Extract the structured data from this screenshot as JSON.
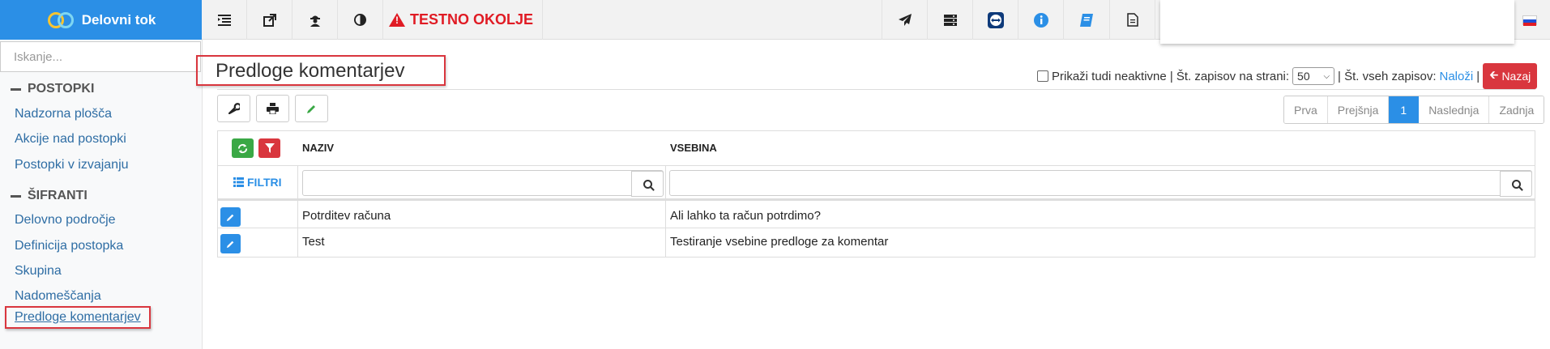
{
  "app": {
    "title": "Delovni tok",
    "environment": "TESTNO OKOLJE"
  },
  "topbar": {
    "icons": [
      "list-outdent-icon",
      "external-link-icon",
      "user-secret-icon",
      "contrast-icon"
    ],
    "right_icons": [
      "paper-plane-icon",
      "server-icon",
      "teamviewer-icon",
      "info-icon",
      "book-icon",
      "document-icon"
    ],
    "language_flag": "slovenian-flag-icon"
  },
  "sidebar": {
    "search_placeholder": "Iskanje...",
    "sections": [
      {
        "title": "POSTOPKI",
        "items": [
          "Nadzorna plošča",
          "Akcije nad postopki",
          "Postopki v izvajanju"
        ]
      },
      {
        "title": "ŠIFRANTI",
        "items": [
          "Delovno področje",
          "Definicija postopka",
          "Skupina",
          "Nadomeščanja",
          "Predloge komentarjev"
        ]
      }
    ]
  },
  "page": {
    "title": "Predloge komentarjev",
    "show_inactive_label": "Prikaži tudi neaktivne |",
    "per_page_label": "Št. zapisov na strani:",
    "per_page_value": "50",
    "total_label": "| Št. vseh zapisov:",
    "load_link": "Naloži",
    "separator": "|",
    "back_button": "Nazaj"
  },
  "actions": [
    "wrench-icon",
    "print-icon",
    "pencil-icon"
  ],
  "pager": {
    "first": "Prva",
    "prev": "Prejšnja",
    "current": "1",
    "next": "Naslednja",
    "last": "Zadnja"
  },
  "grid": {
    "columns": [
      "NAZIV",
      "VSEBINA"
    ],
    "filters_label": "FILTRI",
    "rows": [
      {
        "naziv": "Potrditev računa",
        "vsebina": "Ali lahko ta račun potrdimo?"
      },
      {
        "naziv": "Test",
        "vsebina": "Testiranje vsebine predloge za komentar"
      }
    ]
  },
  "colors": {
    "brand": "#2b8fe6",
    "danger": "#d9363e",
    "success": "#3aa845",
    "link": "#2e6da4"
  }
}
